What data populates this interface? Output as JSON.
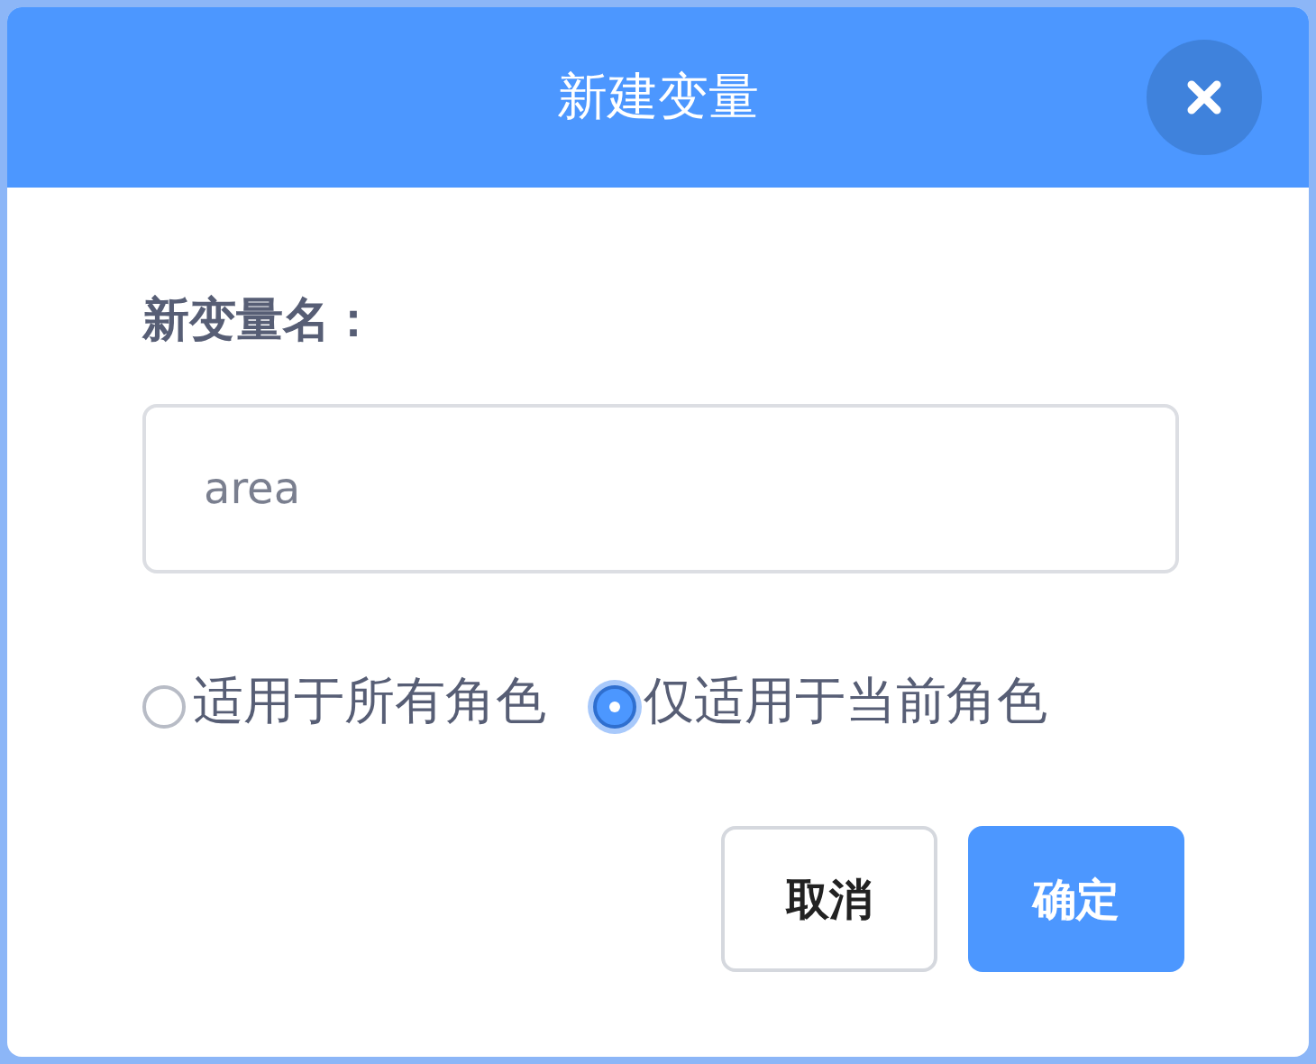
{
  "dialog": {
    "title": "新建变量",
    "name_label": "新变量名：",
    "name_field": {
      "value": "area"
    },
    "scope_options": [
      {
        "label": "适用于所有角色",
        "selected": false
      },
      {
        "label": "仅适用于当前角色",
        "selected": true
      }
    ],
    "buttons": [
      {
        "label": "取消",
        "kind": "secondary"
      },
      {
        "label": "确定",
        "kind": "primary"
      }
    ]
  }
}
